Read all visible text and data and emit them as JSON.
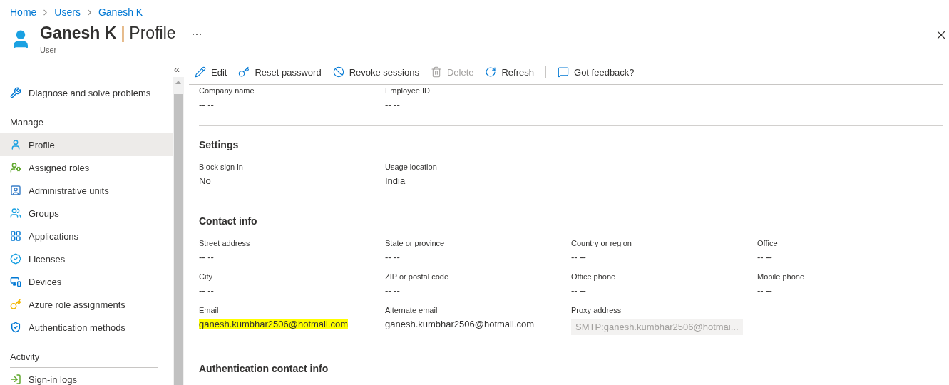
{
  "breadcrumb": [
    "Home",
    "Users",
    "Ganesh K"
  ],
  "header": {
    "name": "Ganesh K",
    "separator": "|",
    "section": "Profile",
    "subtitle": "User",
    "more": "···"
  },
  "sidebar": {
    "collapse": "«",
    "groups": [
      {
        "items": [
          {
            "label": "Diagnose and solve problems",
            "selected": false
          }
        ]
      },
      {
        "heading": "Manage",
        "items": [
          {
            "label": "Profile",
            "selected": true
          },
          {
            "label": "Assigned roles",
            "selected": false
          },
          {
            "label": "Administrative units",
            "selected": false
          },
          {
            "label": "Groups",
            "selected": false
          },
          {
            "label": "Applications",
            "selected": false
          },
          {
            "label": "Licenses",
            "selected": false
          },
          {
            "label": "Devices",
            "selected": false
          },
          {
            "label": "Azure role assignments",
            "selected": false
          },
          {
            "label": "Authentication methods",
            "selected": false
          }
        ]
      },
      {
        "heading": "Activity",
        "items": [
          {
            "label": "Sign-in logs",
            "selected": false
          }
        ]
      }
    ]
  },
  "toolbar": [
    {
      "kind": "button",
      "label": "Edit",
      "disabled": false
    },
    {
      "kind": "button",
      "label": "Reset password",
      "disabled": false
    },
    {
      "kind": "button",
      "label": "Revoke sessions",
      "disabled": false
    },
    {
      "kind": "button",
      "label": "Delete",
      "disabled": true
    },
    {
      "kind": "button",
      "label": "Refresh",
      "disabled": false
    },
    {
      "kind": "separator"
    },
    {
      "kind": "button",
      "label": "Got feedback?",
      "disabled": false
    }
  ],
  "sections": [
    {
      "fields": [
        {
          "label": "Company name",
          "value": "-- --",
          "kind": "text"
        },
        {
          "label": "Employee ID",
          "value": "-- --",
          "kind": "text"
        }
      ]
    },
    {
      "title": "Settings",
      "fields": [
        {
          "label": "Block sign in",
          "value": "No",
          "kind": "text"
        },
        {
          "label": "Usage location",
          "value": "India",
          "kind": "text"
        }
      ]
    },
    {
      "title": "Contact info",
      "fields": [
        {
          "label": "Street address",
          "value": "-- --",
          "kind": "text"
        },
        {
          "label": "State or province",
          "value": "-- --",
          "kind": "text"
        },
        {
          "label": "Country or region",
          "value": "-- --",
          "kind": "text"
        },
        {
          "label": "Office",
          "value": "-- --",
          "kind": "text"
        },
        {
          "label": "City",
          "value": "-- --",
          "kind": "text"
        },
        {
          "label": "ZIP or postal code",
          "value": "-- --",
          "kind": "text"
        },
        {
          "label": "Office phone",
          "value": "-- --",
          "kind": "text"
        },
        {
          "label": "Mobile phone",
          "value": "-- --",
          "kind": "text"
        },
        {
          "label": "Email",
          "value": "ganesh.kumbhar2506@hotmail.com",
          "kind": "text",
          "highlighted": true
        },
        {
          "label": "Alternate email",
          "value": "ganesh.kumbhar2506@hotmail.com",
          "kind": "text"
        },
        {
          "label": "Proxy address",
          "value": "SMTP:ganesh.kumbhar2506@hotmai...",
          "kind": "readonly"
        }
      ]
    },
    {
      "title": "Authentication contact info"
    }
  ]
}
